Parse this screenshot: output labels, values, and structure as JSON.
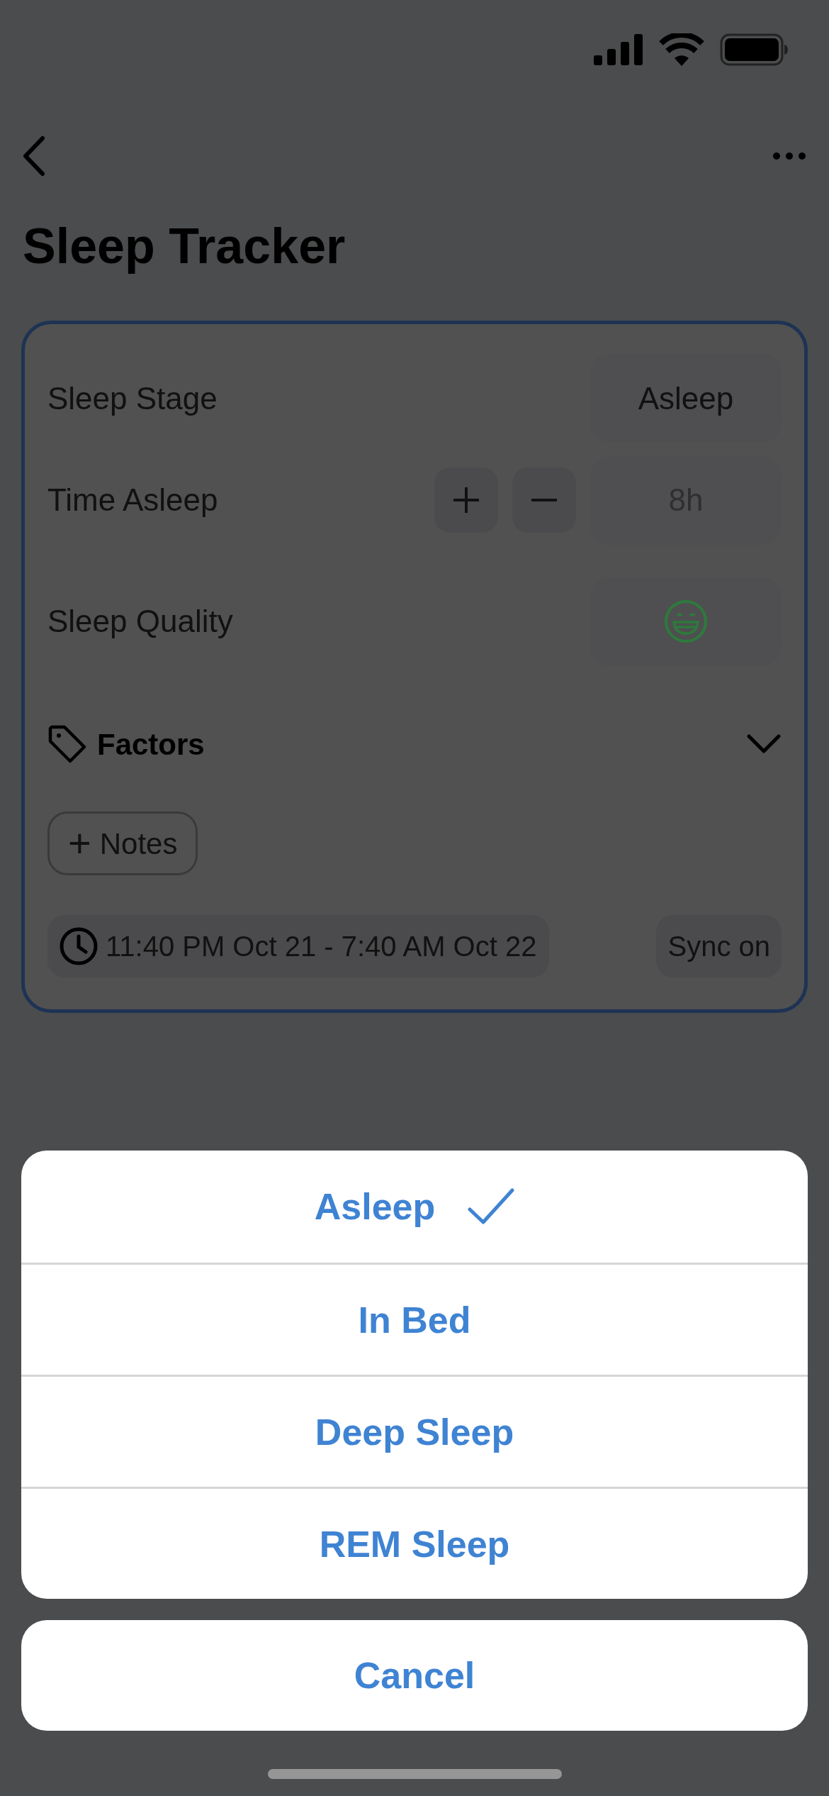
{
  "nav": {
    "title": "Sleep Tracker"
  },
  "card": {
    "rows": [
      {
        "kind": "value",
        "label": "Sleep Stage",
        "value": "Asleep"
      },
      {
        "kind": "stepper",
        "label": "Time Asleep",
        "value": "8h"
      },
      {
        "kind": "emoji",
        "label": "Sleep Quality"
      }
    ],
    "factors": {
      "label": "Factors",
      "expanded": false
    },
    "notes_button": {
      "icon": "+",
      "label": "Notes"
    },
    "time_range": "11:40 PM Oct 21 - 7:40 AM Oct 22",
    "sync": "Sync on"
  },
  "action_sheet": {
    "options": [
      {
        "label": "Asleep",
        "selected": true
      },
      {
        "label": "In Bed",
        "selected": false
      },
      {
        "label": "Deep Sleep",
        "selected": false
      },
      {
        "label": "REM Sleep",
        "selected": false
      }
    ],
    "cancel": "Cancel"
  }
}
